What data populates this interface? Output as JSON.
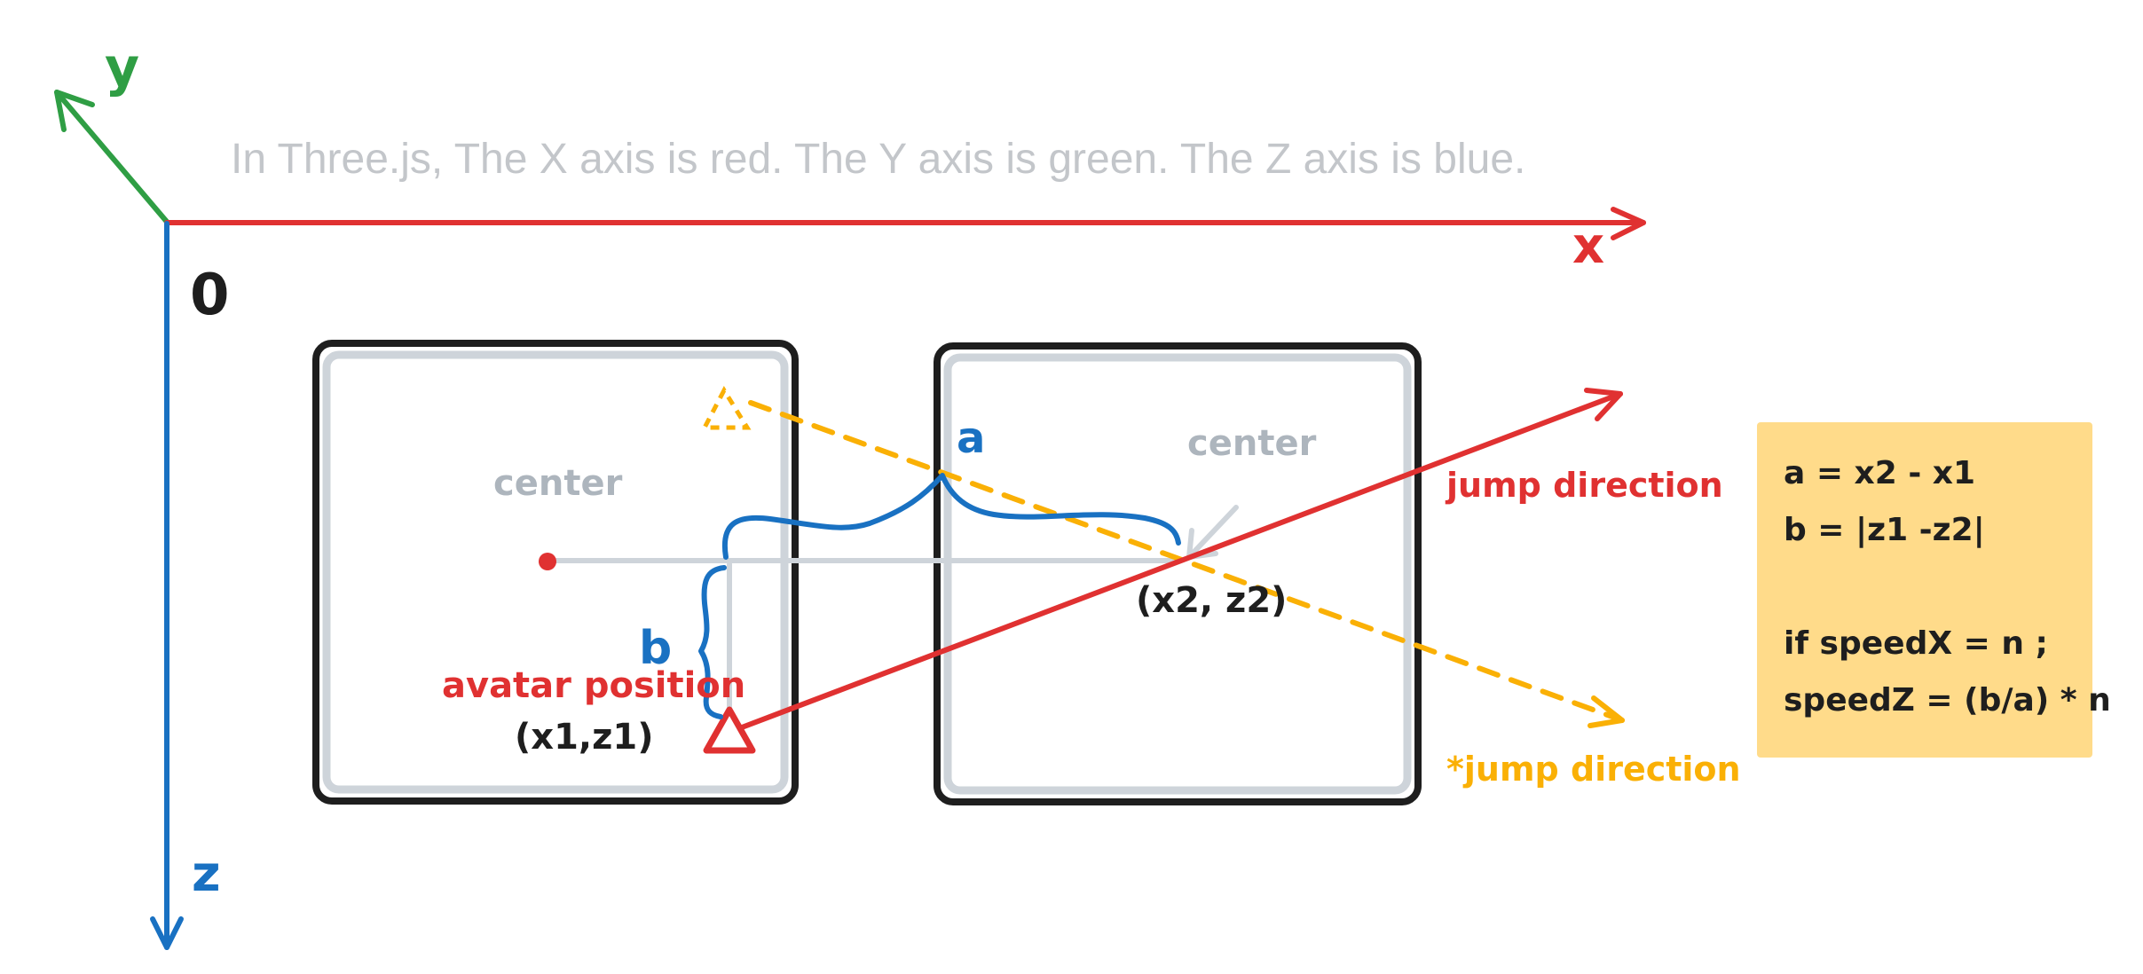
{
  "caption": "In Three.js, The X axis is red. The Y axis is green. The Z axis is blue.",
  "axes": {
    "x_label": "x",
    "y_label": "y",
    "z_label": "z",
    "origin_label": "0",
    "x_color": "#e03131",
    "y_color": "#2f9e44",
    "z_color": "#1971c2"
  },
  "labels": {
    "center_left": "center",
    "center_right": "center",
    "a": "a",
    "b": "b",
    "avatar_position": "avatar position",
    "avatar_coords": "(x1,z1)",
    "target_coords": "(x2, z2)",
    "jump_direction": "jump direction",
    "jump_direction_alt": "*jump direction"
  },
  "note": {
    "background": "#ffdb8a",
    "lines": [
      "a = x2 - x1",
      "b = |z1 -z2|",
      "",
      "if speedX = n ;",
      "speedZ = (b/a) * n"
    ]
  },
  "colors": {
    "red": "#e03131",
    "blue": "#1971c2",
    "green": "#2f9e44",
    "yellow": "#fab005",
    "gray": "#ced4da",
    "label_gray": "#adb5bd",
    "black": "#1e1e1e"
  },
  "icons": {
    "avatar": "triangle-icon",
    "alt_avatar": "dashed-triangle-icon",
    "center": "dot-icon"
  }
}
